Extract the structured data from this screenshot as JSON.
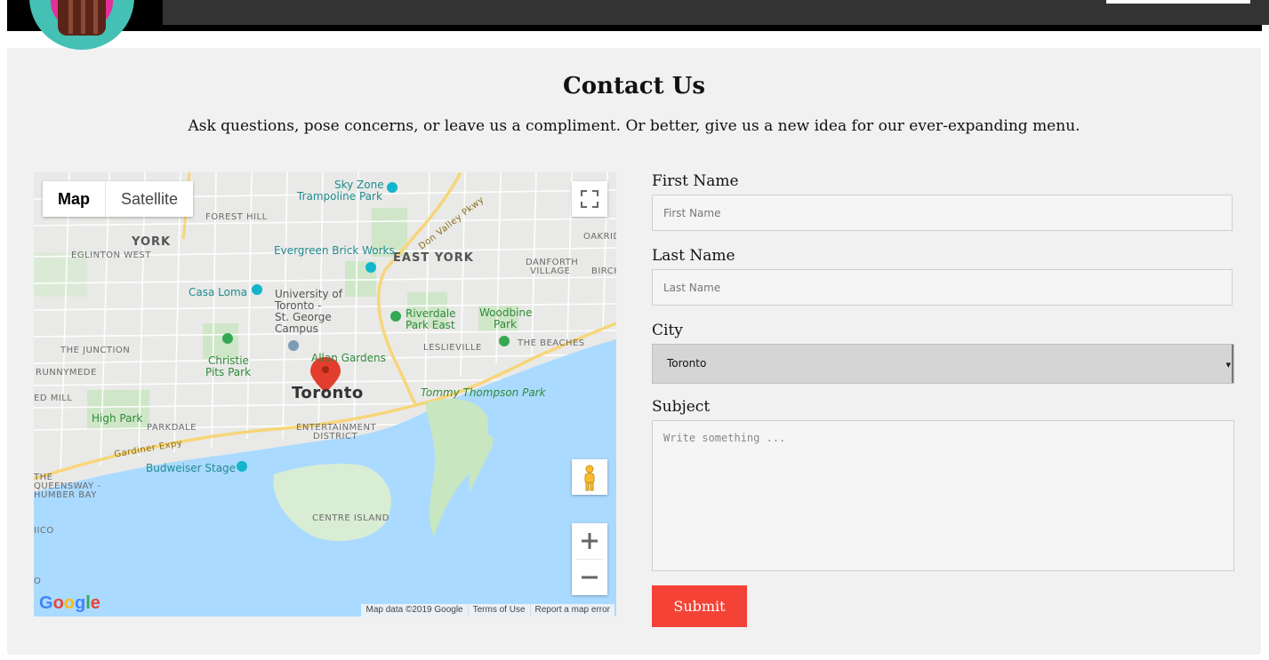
{
  "header": {
    "logo_name": "cupcake-logo"
  },
  "contact": {
    "title": "Contact Us",
    "subtitle": "Ask questions, pose concerns, or leave us a compliment. Or better, give us a new idea for our ever-expanding menu."
  },
  "map": {
    "type_map": "Map",
    "type_satellite": "Satellite",
    "city_label": "Toronto",
    "labels": {
      "skyzone1": "Sky Zone",
      "skyzone2": "Trampoline Park",
      "forest_hill": "FOREST HILL",
      "york": "YORK",
      "eglinton": "EGLINTON WEST",
      "don_valley": "Don Valley Pkwy",
      "oakridge": "OAKRID",
      "evergreen": "Evergreen Brick Works",
      "east_york": "EAST YORK",
      "danforth1": "DANFORTH",
      "danforth2": "VILLAGE",
      "birch": "BIRCH",
      "casa_loma": "Casa Loma",
      "uoft1": "University of",
      "uoft2": "Toronto -",
      "uoft3": "St. George",
      "uoft4": "Campus",
      "riverdale1": "Riverdale",
      "riverdale2": "Park East",
      "woodbine1": "Woodbine",
      "woodbine2": "Park",
      "the_junction": "THE JUNCTION",
      "leslieville": "LESLIEVILLE",
      "the_beaches": "THE BEACHES",
      "allan_gardens": "Allan Gardens",
      "christie1": "Christie",
      "christie2": "Pits Park",
      "runnymede": "RUNNYMEDE",
      "tommy": "Tommy Thompson Park",
      "mill": "ED MILL",
      "high_park": "High Park",
      "parkdale": "PARKDALE",
      "entertainment1": "ENTERTAINMENT",
      "entertainment2": "DISTRICT",
      "gardiner": "Gardiner Expy",
      "budweiser": "Budweiser Stage",
      "queensway1": "THE",
      "queensway2": "QUEENSWAY -",
      "queensway3": "HUMBER BAY",
      "centre_island": "CENTRE ISLAND",
      "mimico": "IICO",
      "o_label": "O"
    },
    "google": "Google",
    "attribution": {
      "data": "Map data ©2019 Google",
      "terms": "Terms of Use",
      "report": "Report a map error"
    }
  },
  "form": {
    "first_name_label": "First Name",
    "first_name_placeholder": "First Name",
    "last_name_label": "Last Name",
    "last_name_placeholder": "Last Name",
    "city_label": "City",
    "city_value": "Toronto",
    "subject_label": "Subject",
    "subject_placeholder": "Write something ...",
    "submit_label": "Submit"
  },
  "colors": {
    "submit_bg": "#f44336",
    "panel_bg": "#f1f1f1",
    "header_bg": "#000000",
    "logo_bg": "#45c0b4"
  }
}
